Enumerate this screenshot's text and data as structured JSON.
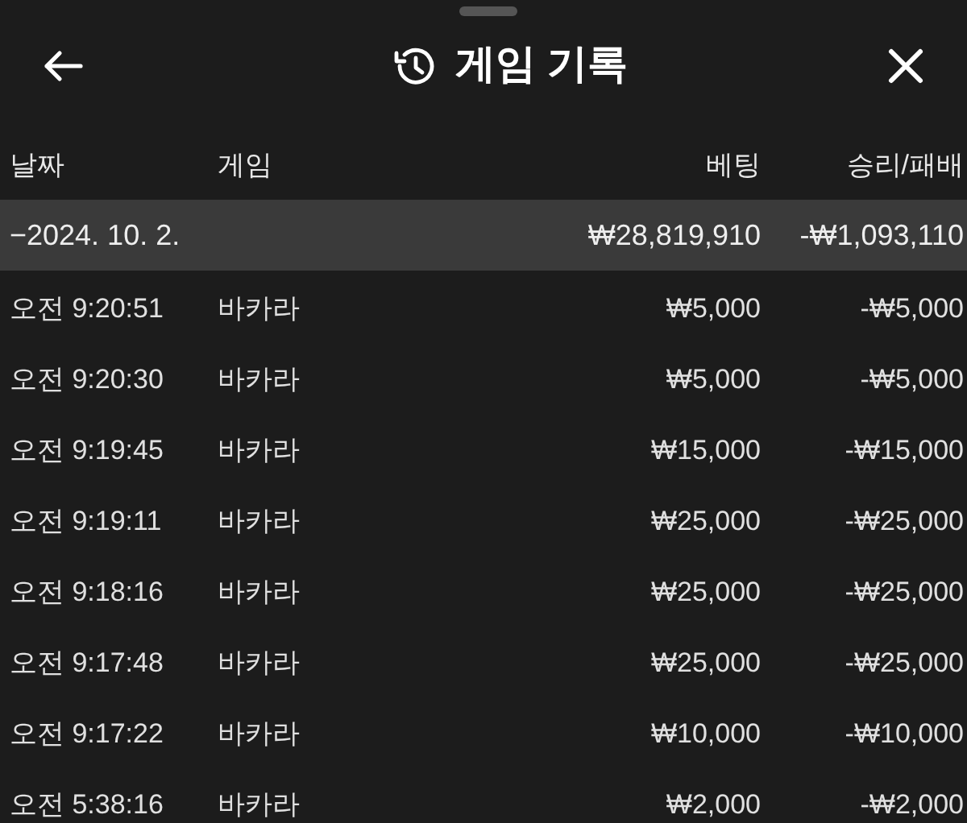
{
  "header": {
    "title": "게임 기록"
  },
  "columns": [
    "날짜",
    "게임",
    "베팅",
    "승리/패배"
  ],
  "group": {
    "date": "−2024. 10. 2.",
    "bet": "₩28,819,910",
    "result": "-₩1,093,110"
  },
  "rows": [
    {
      "time": "오전 9:20:51",
      "game": "바카라",
      "bet": "₩5,000",
      "result": "-₩5,000"
    },
    {
      "time": "오전 9:20:30",
      "game": "바카라",
      "bet": "₩5,000",
      "result": "-₩5,000"
    },
    {
      "time": "오전 9:19:45",
      "game": "바카라",
      "bet": "₩15,000",
      "result": "-₩15,000"
    },
    {
      "time": "오전 9:19:11",
      "game": "바카라",
      "bet": "₩25,000",
      "result": "-₩25,000"
    },
    {
      "time": "오전 9:18:16",
      "game": "바카라",
      "bet": "₩25,000",
      "result": "-₩25,000"
    },
    {
      "time": "오전 9:17:48",
      "game": "바카라",
      "bet": "₩25,000",
      "result": "-₩25,000"
    },
    {
      "time": "오전 9:17:22",
      "game": "바카라",
      "bet": "₩10,000",
      "result": "-₩10,000"
    },
    {
      "time": "오전 5:38:16",
      "game": "바카라",
      "bet": "₩2,000",
      "result": "-₩2,000"
    }
  ]
}
